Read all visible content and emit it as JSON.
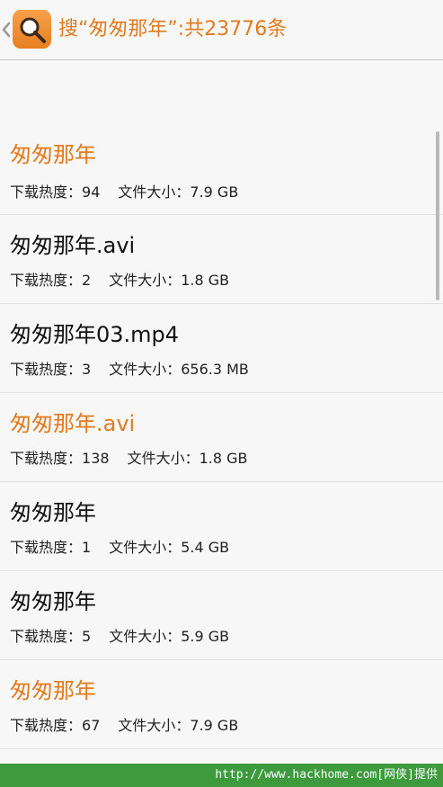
{
  "header": {
    "title": "搜“匆匆那年”:共23776条",
    "icon_name": "search-icon",
    "back_icon_name": "chevron-left-icon"
  },
  "labels": {
    "heat": "下载热度：",
    "size": "文件大小："
  },
  "results": [
    {
      "title": "匆匆那年",
      "heat": "94",
      "size": "7.9 GB",
      "highlighted": true
    },
    {
      "title": "匆匆那年.avi",
      "heat": "2",
      "size": "1.8 GB",
      "highlighted": false
    },
    {
      "title": "匆匆那年03.mp4",
      "heat": "3",
      "size": "656.3 MB",
      "highlighted": false
    },
    {
      "title": "匆匆那年.avi",
      "heat": "138",
      "size": "1.8 GB",
      "highlighted": true
    },
    {
      "title": "匆匆那年",
      "heat": "1",
      "size": "5.4 GB",
      "highlighted": false
    },
    {
      "title": "匆匆那年",
      "heat": "5",
      "size": "5.9 GB",
      "highlighted": false
    },
    {
      "title": "匆匆那年",
      "heat": "67",
      "size": "7.9 GB",
      "highlighted": true
    }
  ],
  "footer": {
    "watermark": "http://www.hackhome.com[网侠]提供"
  },
  "colors": {
    "accent": "#e07b21",
    "text": "#111111",
    "footer": "#3d9b3d"
  }
}
